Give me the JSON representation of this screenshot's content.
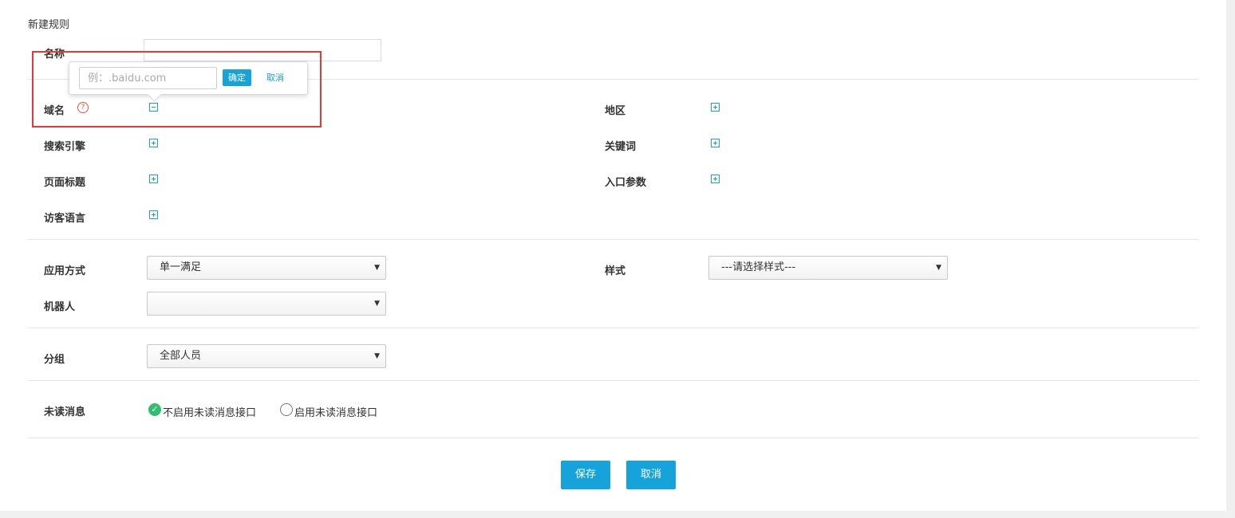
{
  "page_title": "新建规则",
  "name_label": "名称",
  "domain": {
    "label": "域名",
    "help_icon": "question-circle-icon",
    "toggle_icon": "minus-square-icon",
    "popover": {
      "placeholder": "例：.baidu.com",
      "confirm_label": "确定",
      "cancel_label": "取消"
    }
  },
  "conditions": {
    "region": "地区",
    "search_engine": "搜索引擎",
    "keyword": "关键词",
    "page_title": "页面标题",
    "entry_params": "入口参数",
    "visitor_language": "访客语言",
    "add_icon": "plus-square-icon"
  },
  "apply_mode": {
    "label": "应用方式",
    "value": "单一满足"
  },
  "style": {
    "label": "样式",
    "value": "---请选择样式---"
  },
  "robot": {
    "label": "机器人",
    "value": ""
  },
  "group": {
    "label": "分组",
    "value": "全部人员"
  },
  "unread": {
    "label": "未读消息",
    "options": [
      {
        "label": "不启用未读消息接口",
        "selected": true
      },
      {
        "label": "启用未读消息接口",
        "selected": false
      }
    ]
  },
  "buttons": {
    "save": "保存",
    "cancel": "取消"
  },
  "colors": {
    "accent": "#15a3d9",
    "check": "#2fbf71",
    "highlight": "#e53935"
  }
}
